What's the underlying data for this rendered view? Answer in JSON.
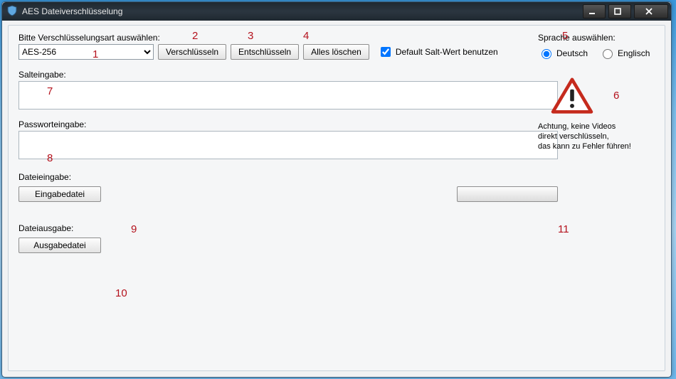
{
  "window": {
    "title": "AES Dateiverschlüsselung"
  },
  "top": {
    "select_label": "Bitte Verschlüsselungsart auswählen:",
    "select_value": "AES-256",
    "encrypt_label": "Verschlüsseln",
    "decrypt_label": "Entschlüsseln",
    "clear_label": "Alles löschen",
    "default_salt_label": "Default Salt-Wert benutzen"
  },
  "language": {
    "label": "Sprache auswählen:",
    "de": "Deutsch",
    "en": "Englisch"
  },
  "warning": {
    "line1": "Achtung, keine Videos",
    "line2": "direkt verschlüsseln,",
    "line3": "das kann zu Fehler führen!"
  },
  "salt": {
    "label": "Salteingabe:",
    "value": ""
  },
  "password": {
    "label": "Passworteingabe:",
    "value": ""
  },
  "file_in": {
    "label": "Dateieingabe:",
    "button": "Eingabedatei"
  },
  "file_out": {
    "label": "Dateiausgabe:",
    "button": "Ausgabedatei"
  },
  "annotations": {
    "n1": "1",
    "n2": "2",
    "n3": "3",
    "n4": "4",
    "n5": "5",
    "n6": "6",
    "n7": "7",
    "n8": "8",
    "n9": "9",
    "n10": "10",
    "n11": "11"
  }
}
